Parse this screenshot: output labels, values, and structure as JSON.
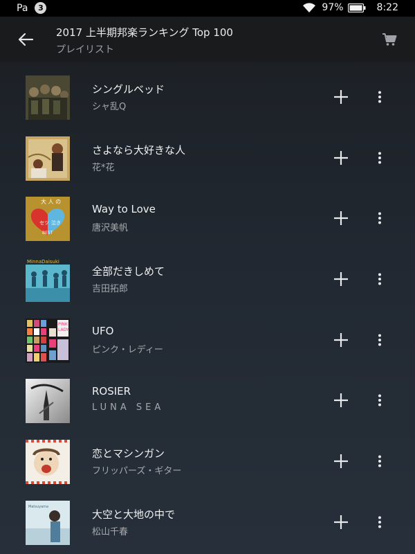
{
  "status_bar": {
    "app_label": "Pa",
    "notification_count": "3",
    "battery_percent": "97%",
    "time": "8:22",
    "icons": [
      "wifi-icon",
      "battery-icon"
    ]
  },
  "header": {
    "title": "2017 上半期邦楽ランキング Top 100",
    "subtitle": "プレイリスト",
    "icons": [
      "back-arrow-icon",
      "cart-icon"
    ]
  },
  "tracks": [
    {
      "title": "シングルベッド",
      "artist": "シャ乱Q",
      "art_colors": [
        "#3c3b2c",
        "#6b6346"
      ]
    },
    {
      "title": "さよなら大好きな人",
      "artist": "花*花",
      "art_colors": [
        "#c9a866",
        "#7a5a34"
      ]
    },
    {
      "title": "Way to Love",
      "artist": "唐沢美帆",
      "art_colors": [
        "#b8922e",
        "#d8332d"
      ]
    },
    {
      "title": "全部だきしめて",
      "artist": "吉田拓郎",
      "art_colors": [
        "#59b6cc",
        "#2c6f8a"
      ]
    },
    {
      "title": "UFO",
      "artist": "ピンク・レディー",
      "art_colors": [
        "#1b1a1a",
        "#e8407b"
      ]
    },
    {
      "title": "ROSIER",
      "artist": "LUNA SEA",
      "art_colors": [
        "#ffffff",
        "#4a4a4a"
      ]
    },
    {
      "title": "恋とマシンガン",
      "artist": "フリッパーズ・ギター",
      "art_colors": [
        "#f3efe6",
        "#d94a3a"
      ]
    },
    {
      "title": "大空と大地の中で",
      "artist": "松山千春",
      "art_colors": [
        "#cfe3ea",
        "#4f7d9a"
      ]
    }
  ],
  "row_action_icons": [
    "plus-icon",
    "more-vertical-icon"
  ],
  "colors": {
    "header_bg": "#1a1b1d",
    "list_bg": "#232a32",
    "text_primary": "#f0f1f2",
    "text_secondary": "#a6a9ad"
  }
}
